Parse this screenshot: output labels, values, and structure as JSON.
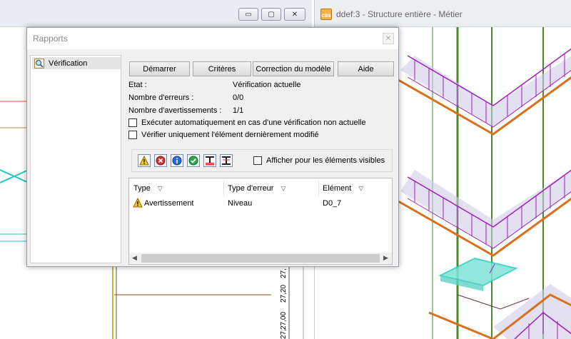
{
  "left_window": {
    "minimize_glyph": "▭",
    "maximize_glyph": "▢",
    "close_glyph": "✕",
    "ruler_labels": [
      "27,",
      "27,20",
      "27,00",
      "27,"
    ]
  },
  "right_window": {
    "icon_text": "CBS",
    "title": "ddef:3 - Structure entière - Métier"
  },
  "dialog": {
    "title": "Rapports",
    "close_glyph": "✕",
    "tree": {
      "item_label": "Vérification"
    },
    "buttons": {
      "start": "Démarrer",
      "criteria": "Critères",
      "model_fix": "Correction du modèle",
      "help": "Aide"
    },
    "info": {
      "state_label": "Etat :",
      "state_value": "Vérification actuelle",
      "errors_label": "Nombre d'erreurs :",
      "errors_value": "0/0",
      "warnings_label": "Nombre d'avertissements :",
      "warnings_value": "1/1"
    },
    "options": {
      "auto_run": "Exécuter automatiquement en cas d'une vérification non actuelle",
      "last_element_only": "Vérifier uniquement l'élément dernièrement modifié"
    },
    "filter": {
      "visible_only": "Afficher pour les éléments visibles"
    },
    "list": {
      "columns": [
        "Type",
        "Type d'erreur",
        "Elément"
      ],
      "rows": [
        {
          "type": "Avertissement",
          "error_type": "Niveau",
          "element": "D0_7"
        }
      ]
    }
  },
  "colors": {
    "magenta": "#a020c0",
    "orange": "#d8701c",
    "teal": "#2ad0c0",
    "green": "#4a8a2a"
  }
}
